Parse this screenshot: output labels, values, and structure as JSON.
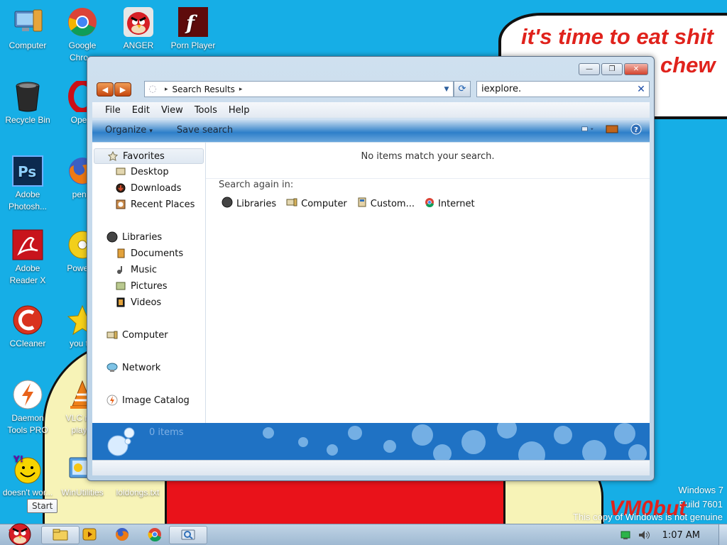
{
  "wallpaper": {
    "speech_line1": "it's time to eat shit",
    "speech_line2": "chew",
    "signature": "VM0but",
    "watermark": {
      "os": "Windows 7",
      "build": "Build 7601",
      "genuine": "This copy of Windows is not genuine"
    }
  },
  "desktop": {
    "icons": [
      {
        "label": "Computer",
        "icon": "computer-icon"
      },
      {
        "label": "Google Chro...",
        "icon": "chrome-icon"
      },
      {
        "label": "ANGER",
        "icon": "angry-bird-icon"
      },
      {
        "label": "Porn Player",
        "icon": "flash-icon"
      },
      {
        "label": "Recycle Bin",
        "icon": "recycle-bin-icon"
      },
      {
        "label": "Ope...",
        "icon": "opera-icon"
      },
      {
        "label": "Adobe Photosh...",
        "icon": "photoshop-icon"
      },
      {
        "label": "penis",
        "icon": "firefox-icon"
      },
      {
        "label": "Adobe Reader X",
        "icon": "acrobat-icon"
      },
      {
        "label": "Power...",
        "icon": "disc-icon"
      },
      {
        "label": "CCleaner",
        "icon": "ccleaner-icon"
      },
      {
        "label": "you t...",
        "icon": "star-icon"
      },
      {
        "label": "Daemon Tools PRO",
        "icon": "daemon-tools-icon"
      },
      {
        "label": "VLC m... play...",
        "icon": "vlc-icon"
      },
      {
        "label": "doesn't wor...",
        "icon": "yahoo-icon"
      },
      {
        "label": "WinUtilities",
        "icon": "winutilities-icon"
      },
      {
        "label": "loldongs.txt",
        "icon": "text-file-icon"
      }
    ]
  },
  "window": {
    "caption": {
      "minimize": "—",
      "maximize": "❐",
      "close": "✕"
    },
    "address": {
      "path": "Search Results"
    },
    "search": {
      "value": "iexplore."
    },
    "menu": [
      "File",
      "Edit",
      "View",
      "Tools",
      "Help"
    ],
    "commands": {
      "organize": "Organize",
      "organize_arrow": "▾",
      "save_search": "Save search"
    },
    "nav": {
      "favorites": "Favorites",
      "desktop": "Desktop",
      "downloads": "Downloads",
      "recent_places": "Recent Places",
      "libraries": "Libraries",
      "documents": "Documents",
      "music": "Music",
      "pictures": "Pictures",
      "videos": "Videos",
      "computer": "Computer",
      "network": "Network",
      "image_catalog": "Image Catalog"
    },
    "content": {
      "no_items": "No items match your search.",
      "search_again": "Search again in:",
      "locations": [
        "Libraries",
        "Computer",
        "Custom...",
        "Internet"
      ]
    },
    "details": {
      "count": "0 items"
    }
  },
  "taskbar": {
    "tooltip": "Start",
    "clock": "1:07 AM",
    "pinned": [
      "explorer-icon",
      "media-player-icon",
      "firefox-icon",
      "chrome-icon",
      "search-window-icon"
    ]
  },
  "colors": {
    "desktop_bg": "#16aee6",
    "accent": "#1f72c4",
    "wallpaper_red": "#e9121a"
  }
}
